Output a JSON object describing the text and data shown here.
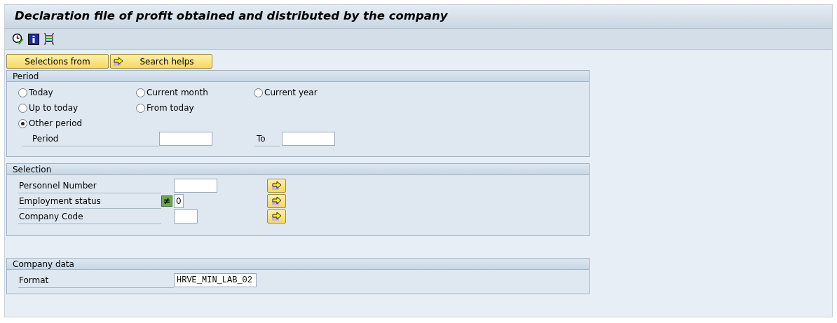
{
  "title": "Declaration file of profit obtained and distributed by the company",
  "buttons": [
    {
      "label": "Selections from",
      "kind": "plain"
    },
    {
      "label": "Search helps",
      "kind": "arrow"
    }
  ],
  "period": {
    "title": "Period",
    "option_rows": [
      [
        {
          "label": "Today",
          "selected": false
        },
        {
          "label": "Current month",
          "selected": false
        },
        {
          "label": "Current year",
          "selected": false
        }
      ],
      [
        {
          "label": "Up to today",
          "selected": false
        },
        {
          "label": "From today",
          "selected": false
        }
      ],
      [
        {
          "label": "Other period",
          "selected": true
        }
      ]
    ],
    "from_label": "Period",
    "to_label": "To"
  },
  "selection": {
    "title": "Selection",
    "fields": [
      {
        "label": "Personnel Number",
        "kind": "plain"
      },
      {
        "label": "Employment status",
        "kind": "option",
        "value": "0"
      },
      {
        "label": "Company Code",
        "kind": "plain"
      }
    ]
  },
  "company_data": {
    "title": "Company data",
    "fields": [
      {
        "label": "Format",
        "value": "HRVE_MIN_LAB_02"
      }
    ]
  }
}
